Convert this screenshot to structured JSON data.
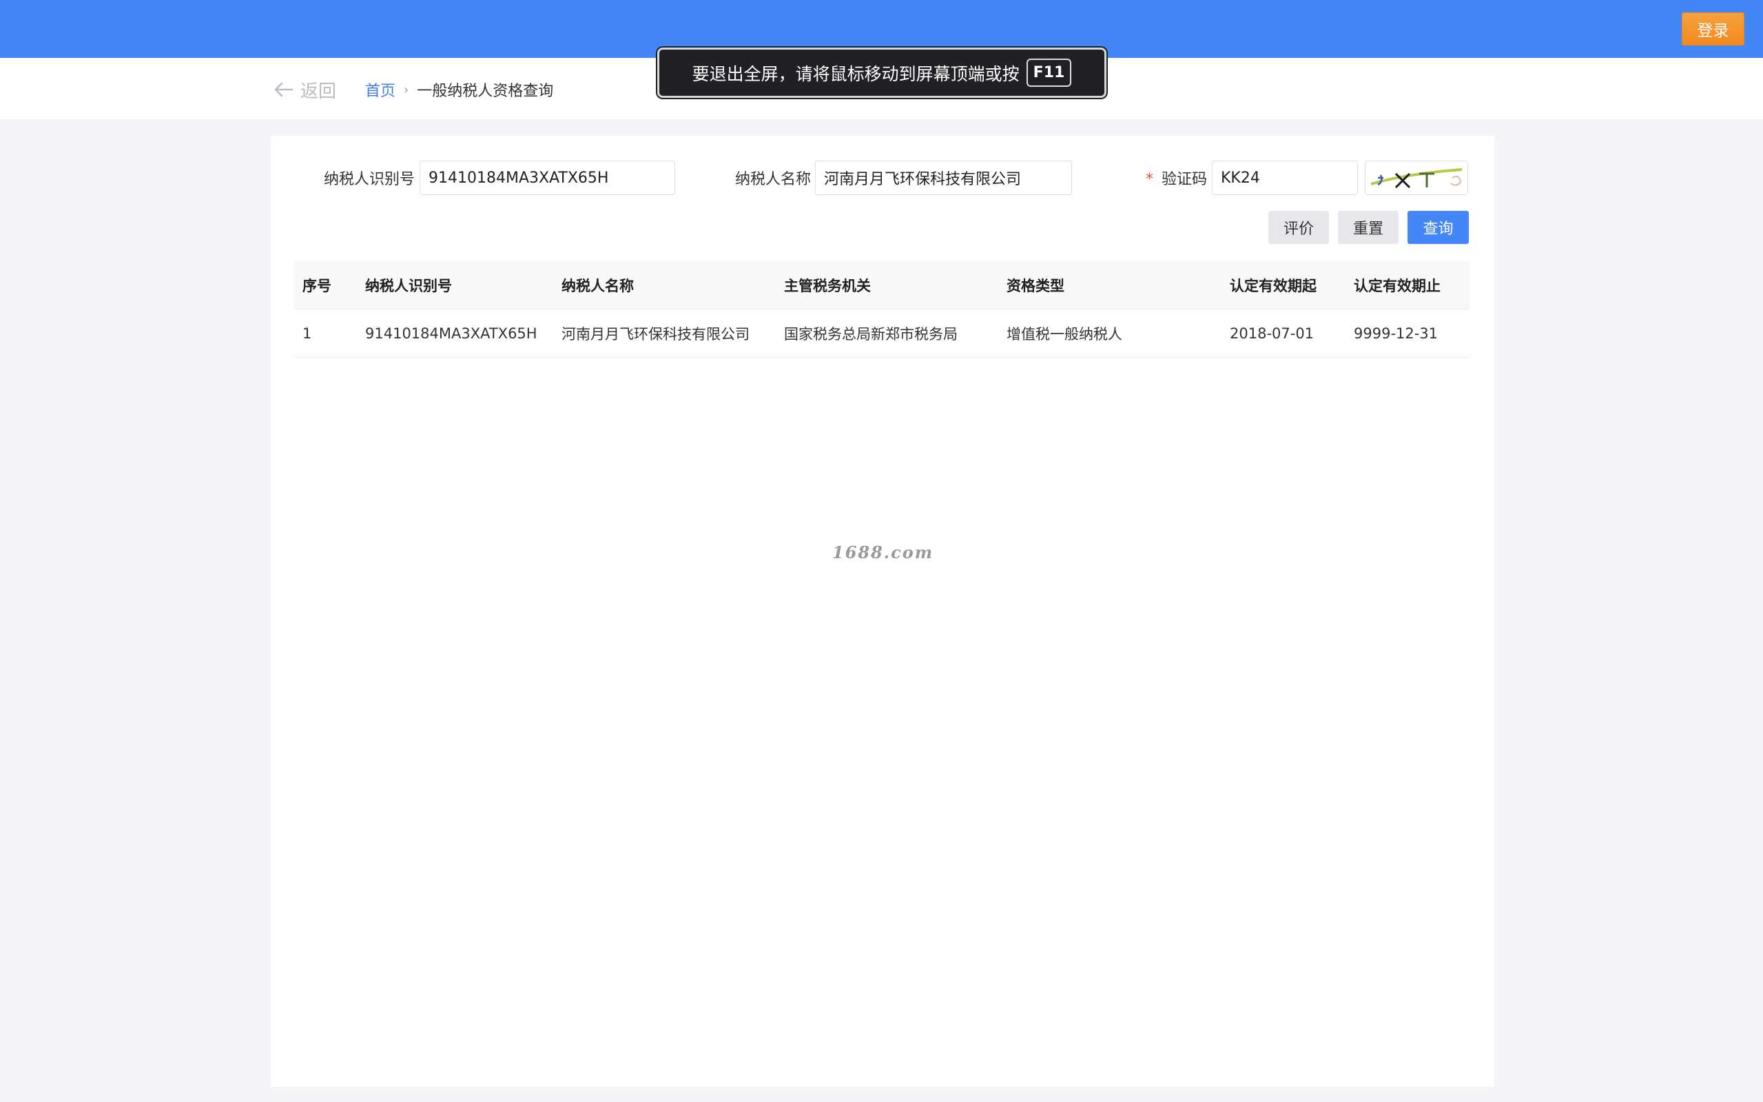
{
  "header": {
    "login_label": "登录"
  },
  "nav": {
    "back_label": "返回",
    "breadcrumb": {
      "home": "首页",
      "separator": "›",
      "current": "一般纳税人资格查询"
    }
  },
  "fullscreen_toast": {
    "message": "要退出全屏，请将鼠标移动到屏幕顶端或按",
    "key": "F11"
  },
  "form": {
    "taxpayer_id_label": "纳税人识别号",
    "taxpayer_id_value": "91410184MA3XATX65H",
    "taxpayer_name_label": "纳税人名称",
    "taxpayer_name_value": "河南月月飞环保科技有限公司",
    "captcha_required_mark": "*",
    "captcha_label": "验证码",
    "captcha_value": "KK24"
  },
  "actions": {
    "evaluate": "评价",
    "reset": "重置",
    "query": "查询"
  },
  "table": {
    "columns": [
      "序号",
      "纳税人识别号",
      "纳税人名称",
      "主管税务机关",
      "资格类型",
      "认定有效期起",
      "认定有效期止"
    ],
    "rows": [
      [
        "1",
        "91410184MA3XATX65H",
        "河南月月飞环保科技有限公司",
        "国家税务总局新郑市税务局",
        "增值税一般纳税人",
        "2018-07-01",
        "9999-12-31"
      ]
    ]
  },
  "watermark": "1688.com",
  "colors": {
    "primary": "#4287f5",
    "login": "#f18a1e",
    "required": "#e74c3c"
  }
}
